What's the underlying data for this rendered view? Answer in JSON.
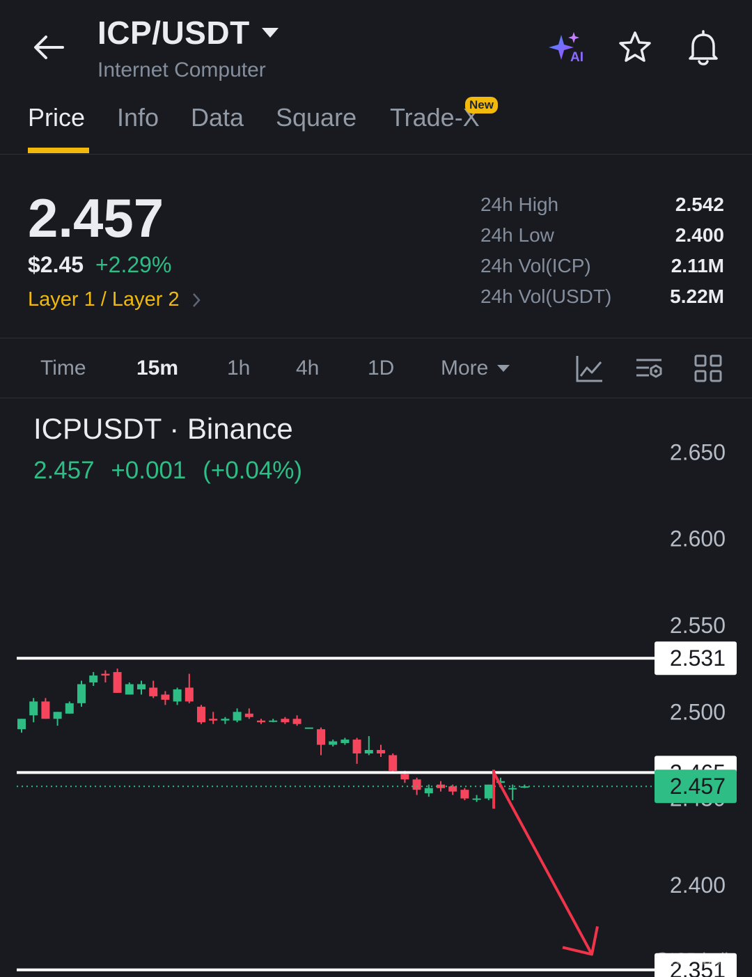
{
  "header": {
    "title": "ICP/USDT",
    "subtitle": "Internet Computer",
    "ai_badge": "AI",
    "icons": [
      "back-arrow-icon",
      "ai-sparkle-icon",
      "star-icon",
      "bell-icon"
    ]
  },
  "tabs": [
    {
      "label": "Price",
      "active": true
    },
    {
      "label": "Info"
    },
    {
      "label": "Data"
    },
    {
      "label": "Square"
    },
    {
      "label": "Trade-X",
      "badge": "New"
    }
  ],
  "price": {
    "last": "2.457",
    "usd": "$2.45",
    "change_pct": "+2.29%",
    "sector": "Layer 1 / Layer 2"
  },
  "stats": [
    {
      "label": "24h High",
      "value": "2.542"
    },
    {
      "label": "24h Low",
      "value": "2.400"
    },
    {
      "label": "24h Vol(ICP)",
      "value": "2.11M"
    },
    {
      "label": "24h Vol(USDT)",
      "value": "5.22M"
    }
  ],
  "timeframes": {
    "items": [
      {
        "label": "Time"
      },
      {
        "label": "15m",
        "active": true
      },
      {
        "label": "1h"
      },
      {
        "label": "4h"
      },
      {
        "label": "1D"
      },
      {
        "label": "More"
      }
    ],
    "tool_icons": [
      "indicator-chart-icon",
      "chart-settings-icon",
      "grid-layout-icon"
    ]
  },
  "chart_header": {
    "title": "ICPUSDT · Binance",
    "last": "2.457",
    "change": "+0.001",
    "change_pct": "(+0.04%)"
  },
  "watermark": "@ICP bull",
  "colors": {
    "background": "#181a20",
    "up": "#2ebd85",
    "down": "#f6465d",
    "accent": "#f0b90b",
    "annotation_arrow": "#f0344a"
  },
  "chart_data": {
    "type": "candlestick",
    "ylim": [
      2.33,
      2.665
    ],
    "y_ticks": [
      "2.650",
      "2.600",
      "2.550",
      "2.500",
      "2.450",
      "2.400"
    ],
    "current_price": "2.457",
    "horizontal_lines": [
      {
        "value": 2.531,
        "label": "2.531"
      },
      {
        "value": 2.465,
        "label": "2.465"
      },
      {
        "value": 2.351,
        "label": "2.351"
      }
    ],
    "annotation_arrow": {
      "from_price": 2.465,
      "to_price": 2.36,
      "direction": "down"
    },
    "candles": [
      {
        "o": 2.49,
        "h": 2.496,
        "l": 2.488,
        "c": 2.496
      },
      {
        "o": 2.498,
        "h": 2.508,
        "l": 2.494,
        "c": 2.506
      },
      {
        "o": 2.506,
        "h": 2.508,
        "l": 2.496,
        "c": 2.496
      },
      {
        "o": 2.496,
        "h": 2.5,
        "l": 2.492,
        "c": 2.5
      },
      {
        "o": 2.499,
        "h": 2.506,
        "l": 2.499,
        "c": 2.505
      },
      {
        "o": 2.505,
        "h": 2.518,
        "l": 2.503,
        "c": 2.516
      },
      {
        "o": 2.517,
        "h": 2.523,
        "l": 2.515,
        "c": 2.521
      },
      {
        "o": 2.522,
        "h": 2.524,
        "l": 2.517,
        "c": 2.521
      },
      {
        "o": 2.523,
        "h": 2.525,
        "l": 2.511,
        "c": 2.511
      },
      {
        "o": 2.51,
        "h": 2.517,
        "l": 2.51,
        "c": 2.516
      },
      {
        "o": 2.513,
        "h": 2.518,
        "l": 2.51,
        "c": 2.516
      },
      {
        "o": 2.514,
        "h": 2.518,
        "l": 2.508,
        "c": 2.509
      },
      {
        "o": 2.51,
        "h": 2.512,
        "l": 2.504,
        "c": 2.507
      },
      {
        "o": 2.506,
        "h": 2.514,
        "l": 2.504,
        "c": 2.513
      },
      {
        "o": 2.514,
        "h": 2.522,
        "l": 2.505,
        "c": 2.506
      },
      {
        "o": 2.503,
        "h": 2.504,
        "l": 2.493,
        "c": 2.494
      },
      {
        "o": 2.496,
        "h": 2.5,
        "l": 2.493,
        "c": 2.495
      },
      {
        "o": 2.495,
        "h": 2.497,
        "l": 2.493,
        "c": 2.496
      },
      {
        "o": 2.495,
        "h": 2.502,
        "l": 2.494,
        "c": 2.5
      },
      {
        "o": 2.499,
        "h": 2.502,
        "l": 2.496,
        "c": 2.497
      },
      {
        "o": 2.495,
        "h": 2.496,
        "l": 2.493,
        "c": 2.494
      },
      {
        "o": 2.495,
        "h": 2.496,
        "l": 2.494,
        "c": 2.495
      },
      {
        "o": 2.496,
        "h": 2.497,
        "l": 2.493,
        "c": 2.494
      },
      {
        "o": 2.496,
        "h": 2.498,
        "l": 2.492,
        "c": 2.493
      },
      {
        "o": 2.491,
        "h": 2.491,
        "l": 2.491,
        "c": 2.491
      },
      {
        "o": 2.49,
        "h": 2.491,
        "l": 2.475,
        "c": 2.481
      },
      {
        "o": 2.481,
        "h": 2.484,
        "l": 2.48,
        "c": 2.483
      },
      {
        "o": 2.482,
        "h": 2.485,
        "l": 2.481,
        "c": 2.484
      },
      {
        "o": 2.484,
        "h": 2.485,
        "l": 2.47,
        "c": 2.476
      },
      {
        "o": 2.476,
        "h": 2.486,
        "l": 2.475,
        "c": 2.478
      },
      {
        "o": 2.478,
        "h": 2.481,
        "l": 2.474,
        "c": 2.476
      },
      {
        "o": 2.475,
        "h": 2.476,
        "l": 2.465,
        "c": 2.466
      },
      {
        "o": 2.464,
        "h": 2.466,
        "l": 2.459,
        "c": 2.461
      },
      {
        "o": 2.461,
        "h": 2.462,
        "l": 2.452,
        "c": 2.455
      },
      {
        "o": 2.453,
        "h": 2.458,
        "l": 2.451,
        "c": 2.456
      },
      {
        "o": 2.458,
        "h": 2.46,
        "l": 2.454,
        "c": 2.456
      },
      {
        "o": 2.457,
        "h": 2.458,
        "l": 2.452,
        "c": 2.454
      },
      {
        "o": 2.455,
        "h": 2.456,
        "l": 2.449,
        "c": 2.45
      },
      {
        "o": 2.45,
        "h": 2.452,
        "l": 2.448,
        "c": 2.45
      },
      {
        "o": 2.45,
        "h": 2.458,
        "l": 2.449,
        "c": 2.458
      },
      {
        "o": 2.459,
        "h": 2.462,
        "l": 2.457,
        "c": 2.46
      },
      {
        "o": 2.456,
        "h": 2.458,
        "l": 2.449,
        "c": 2.456
      },
      {
        "o": 2.457,
        "h": 2.458,
        "l": 2.456,
        "c": 2.457
      }
    ]
  }
}
